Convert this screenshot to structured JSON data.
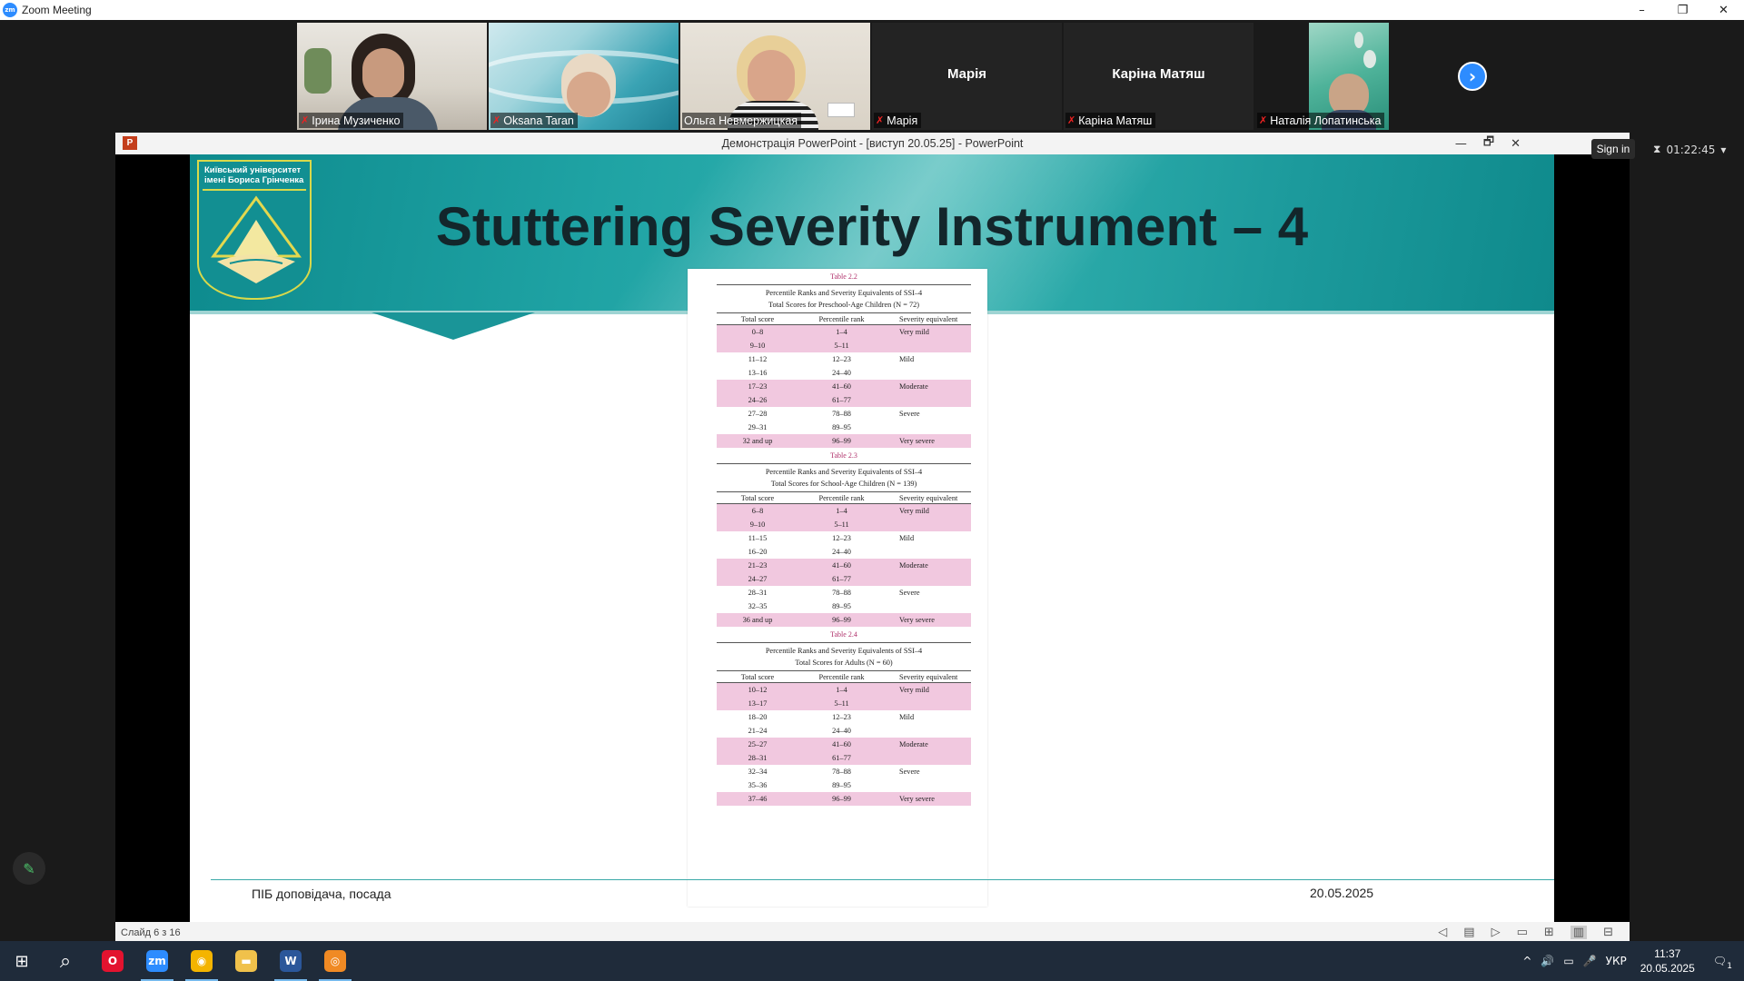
{
  "zoom": {
    "window_title": "Zoom Meeting",
    "logo_text": "zm",
    "window_controls": {
      "minimize": "–",
      "restore": "❐",
      "close": "✕"
    },
    "participants": [
      {
        "name": "Ірина Музиченко",
        "center_name": "",
        "video": true
      },
      {
        "name": "Oksana Taran",
        "center_name": "",
        "video": true
      },
      {
        "name": "Ольга Невмержицкая",
        "center_name": "",
        "video": true
      },
      {
        "name": "Марія",
        "center_name": "Марія",
        "video": false
      },
      {
        "name": "Каріна Матяш",
        "center_name": "Каріна Матяш",
        "video": false
      },
      {
        "name": "Наталія Лопатинська",
        "center_name": "",
        "video": true
      }
    ],
    "next_page_icon": "›",
    "sign_in": "Sign in",
    "timer": "01:22:45",
    "timer_icon": "⧗",
    "timer_dropdown": "▾",
    "annotate_icon": "✎"
  },
  "ppt": {
    "title": "Демонстрація PowerPoint - [виступ 20.05.25] - PowerPoint",
    "icon_text": "P",
    "controls": {
      "minimize": "—",
      "restore": "🗗",
      "close": "✕"
    },
    "slide_counter": "Слайд 6 з 16",
    "status_icons": [
      "◁",
      "▤",
      "▷",
      "▭",
      "⊞",
      "▥",
      "⊟"
    ]
  },
  "slide": {
    "logo_text": "Київський університет імені Бориса Грінченка",
    "title": "Stuttering Severity Instrument – 4",
    "footer_left": "ПІБ доповідача, посада",
    "footer_right": "20.05.2025"
  },
  "tables": [
    {
      "label": "Table 2.2",
      "caption_line1": "Percentile Ranks and Severity Equivalents of SSI–4",
      "caption_line2": "Total Scores for Preschool-Age Children (N = 72)",
      "headers": [
        "Total score",
        "Percentile rank",
        "Severity equivalent"
      ],
      "rows": [
        [
          "0–8",
          "1–4",
          "Very mild"
        ],
        [
          "9–10",
          "5–11",
          ""
        ],
        [
          "11–12",
          "12–23",
          "Mild"
        ],
        [
          "13–16",
          "24–40",
          ""
        ],
        [
          "17–23",
          "41–60",
          "Moderate"
        ],
        [
          "24–26",
          "61–77",
          ""
        ],
        [
          "27–28",
          "78–88",
          "Severe"
        ],
        [
          "29–31",
          "89–95",
          ""
        ],
        [
          "32 and up",
          "96–99",
          "Very severe"
        ]
      ]
    },
    {
      "label": "Table 2.3",
      "caption_line1": "Percentile Ranks and Severity Equivalents of SSI–4",
      "caption_line2": "Total Scores for School-Age Children (N = 139)",
      "headers": [
        "Total score",
        "Percentile rank",
        "Severity equivalent"
      ],
      "rows": [
        [
          "6–8",
          "1–4",
          "Very mild"
        ],
        [
          "9–10",
          "5–11",
          ""
        ],
        [
          "11–15",
          "12–23",
          "Mild"
        ],
        [
          "16–20",
          "24–40",
          ""
        ],
        [
          "21–23",
          "41–60",
          "Moderate"
        ],
        [
          "24–27",
          "61–77",
          ""
        ],
        [
          "28–31",
          "78–88",
          "Severe"
        ],
        [
          "32–35",
          "89–95",
          ""
        ],
        [
          "36 and up",
          "96–99",
          "Very severe"
        ]
      ]
    },
    {
      "label": "Table 2.4",
      "caption_line1": "Percentile Ranks and Severity Equivalents of SSI–4",
      "caption_line2": "Total Scores for Adults (N = 60)",
      "headers": [
        "Total score",
        "Percentile rank",
        "Severity equivalent"
      ],
      "rows": [
        [
          "10–12",
          "1–4",
          "Very mild"
        ],
        [
          "13–17",
          "5–11",
          ""
        ],
        [
          "18–20",
          "12–23",
          "Mild"
        ],
        [
          "21–24",
          "24–40",
          ""
        ],
        [
          "25–27",
          "41–60",
          "Moderate"
        ],
        [
          "28–31",
          "61–77",
          ""
        ],
        [
          "32–34",
          "78–88",
          "Severe"
        ],
        [
          "35–36",
          "89–95",
          ""
        ],
        [
          "37–46",
          "96–99",
          "Very severe"
        ]
      ]
    }
  ],
  "taskbar": {
    "start_icon": "⊞",
    "search_icon": "⌕",
    "apps": [
      {
        "icon": "O",
        "name": "opera-icon",
        "color": "#e3132f",
        "running": false
      },
      {
        "icon": "zm",
        "name": "zoom-app-icon",
        "color": "#2d8cff",
        "running": true
      },
      {
        "icon": "◉",
        "name": "chrome-icon",
        "color": "#f4b400",
        "running": true
      },
      {
        "icon": "▬",
        "name": "file-explorer-icon",
        "color": "#f0c14b",
        "running": false
      },
      {
        "icon": "W",
        "name": "word-icon",
        "color": "#2b579a",
        "running": true
      },
      {
        "icon": "◎",
        "name": "viewer-icon",
        "color": "#f08a24",
        "running": true
      }
    ],
    "tray_chevron": "^",
    "volume_icon": "🔊",
    "network_icon": "▭",
    "mic_icon": "🎤",
    "language": "УКР",
    "time": "11:37",
    "date": "20.05.2025",
    "notification_icon": "🗨",
    "notification_count": "1"
  }
}
